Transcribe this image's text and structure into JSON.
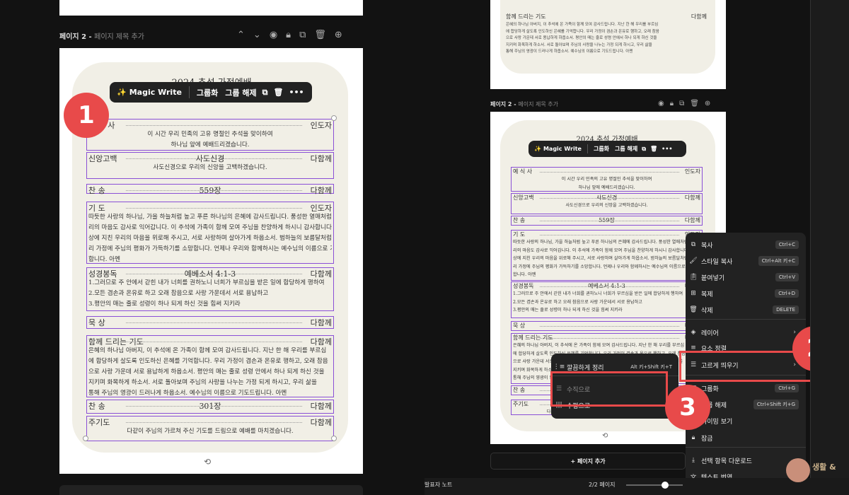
{
  "left": {
    "page_label": "페이지 2 -",
    "page_title_placeholder": "페이지 제목 추가",
    "toolbar": {
      "magic": "Magic Write",
      "group": "그룹화",
      "ungroup": "그룹 해제"
    },
    "badge": "1",
    "doc_title": "2024 추석 가정예배",
    "rows": [
      {
        "left": "예 식 사",
        "right": "인도자",
        "body": [
          "이 시간 우리 민족의 고유 명절인 추석을 맞이하여",
          "하나님 앞에 예배드리겠습니다."
        ]
      },
      {
        "left": "신앙고백",
        "center": "사도신경",
        "right": "다함께",
        "body": [
          "사도신경으로 우리의 신앙을 고백하겠습니다."
        ]
      },
      {
        "left": "찬 송",
        "center": "559장",
        "right": "다함께"
      },
      {
        "left": "기 도",
        "right": "인도자",
        "body": [
          "따듯한 사랑의 하나님, 가을 하늘처럼 높고 푸른 하나님의 은혜에 감사드립니다. 풍성한 열매처럼 우",
          "리의 마음도 감사로 익어갑니다. 이 추석에 가족이 함께 모여 주님을 찬양하게 하시니 감사합니다. 세",
          "상에 지친 우리의 마음을 위로해 주시고, 서로 사랑하며 살아가게 하옵소서. 범하늘의 보름달처럼 우",
          "리 가정에 주님의 평화가 가득하기를 소망합니다. 언제나 우리와 함께하시는 예수님의 이름으로 기도",
          "합니다. 아멘"
        ]
      },
      {
        "left": "성경봉독",
        "center": "예베소서 4:1-3",
        "right": "다함께",
        "body": [
          "1.그러므로 주 안에서 갇힌 내가 너희를 권하노니 너희가 부르심을 받은 일에 합당하게 행하여",
          "2.모든 겸손과 온유로 하고 오래 참음으로 사랑 가운데서 서로 용납하고",
          "3.평안의 매는 줄로 성령이 하나 되게 하신 것을 힘써 지키라"
        ]
      },
      {
        "left": "묵 상",
        "right": "다함께"
      },
      {
        "left": "함께 드리는 기도",
        "right": "다함께",
        "body": [
          "은혜의 하나님 아버지, 이 추석에 온 가족이 함께 모여 감사드립니다. 지난 한 해 우리를 부르심",
          "에 합당하게 살도록 인도하신 은혜를 기억합니다. 우리 가정이 겸손과 온유로 행하고, 오래 참음",
          "으로 사랑 가운데 서로 용납하게 하옵소서. 평안의 매는 줄로 성령 안에서 하나 되게 하신 것을",
          "지키며 화목하게 하소서. 서로 돌아보며 주님의 사랑을 나누는 가정 되게 하시고, 우리 삶을",
          "통해 주님의 영광이 드러나게 하옵소서. 예수님의 이름으로 기도드립니다. 아멘"
        ]
      },
      {
        "left": "찬 송",
        "center": "301장",
        "right": "다함께"
      },
      {
        "left": "주기도",
        "right": "다함께",
        "body": [
          "다같이 주님의 가르쳐 주신 기도를 드림으로 예배를 마치겠습니다."
        ]
      }
    ]
  },
  "right": {
    "top_row": {
      "left": "함께 드리는 기도",
      "right": "다함께"
    },
    "top_body": [
      "은혜의 하나님 아버지, 이 추석에 온 가족이 함께 모여 감사드립니다. 지난 한 해 우리를 부르심",
      "에 합당하게 살도록 인도하신 은혜를 기억합니다. 우리 가정이 겸손과 온유로 행하고, 오래 참음",
      "으로 사랑 가운데 서로 용납하게 하옵소서. 평안의 매는 줄로 성령 안에서 하나 되게 하신 것을",
      "지키며 화목하게 하소서. 서로 돌아보며 주님의 사랑을 나누는 가정 되게 하시고, 우리 삶을",
      "통해 주님의 영광이 드러나게 하옵소서. 예수님의 이름으로 기도드립니다. 아멘"
    ],
    "page_label": "페이지 2 -",
    "page_title_placeholder": "페이지 제목 추가",
    "toolbar": {
      "magic": "Magic Write",
      "group": "그룹화",
      "ungroup": "그룹 해제"
    },
    "context_menu": [
      {
        "label": "복사",
        "shortcut": "Ctrl+C",
        "icon": "copy-icon"
      },
      {
        "label": "스타일 복사",
        "shortcut": "Ctrl+Alt 키+C",
        "icon": "paint-roller-icon"
      },
      {
        "label": "붙여넣기",
        "shortcut": "Ctrl+V",
        "icon": "clipboard-icon"
      },
      {
        "label": "복제",
        "shortcut": "Ctrl+D",
        "icon": "duplicate-icon"
      },
      {
        "label": "삭제",
        "shortcut": "DELETE",
        "icon": "trash-icon"
      },
      {
        "label": "레이어",
        "shortcut": "›",
        "icon": "layers-icon"
      },
      {
        "label": "요소 정렬",
        "shortcut": "",
        "icon": "align-icon"
      },
      {
        "label": "고르게 띄우기",
        "shortcut": "›",
        "icon": "spacing-icon"
      },
      {
        "label": "그룹화",
        "shortcut": "Ctrl+G",
        "icon": "group-icon"
      },
      {
        "label": "그룹 해제",
        "shortcut": "Ctrl+Shift 키+G",
        "icon": "ungroup-icon"
      },
      {
        "label": "타이밍 보기",
        "shortcut": "",
        "icon": "timing-icon"
      },
      {
        "label": "잠금",
        "shortcut": "",
        "icon": "lock-icon"
      },
      {
        "label": "선택 항목 다운로드",
        "shortcut": "",
        "icon": "download-icon"
      },
      {
        "label": "텍스트 번역",
        "shortcut": "",
        "icon": "translate-icon"
      }
    ],
    "submenu": [
      {
        "label": "깔끔하게 정리",
        "shortcut": "Alt 키+Shift 키+T"
      },
      {
        "label": "수직으로",
        "shortcut": ""
      },
      {
        "label": "수평으로",
        "shortcut": ""
      }
    ],
    "badge2": "2",
    "badge3": "3",
    "add_page": "+ 페이지 추가",
    "footer_note": "발표자 노트",
    "footer_pages": "2/2 페이지",
    "watermark": "생활 &"
  }
}
